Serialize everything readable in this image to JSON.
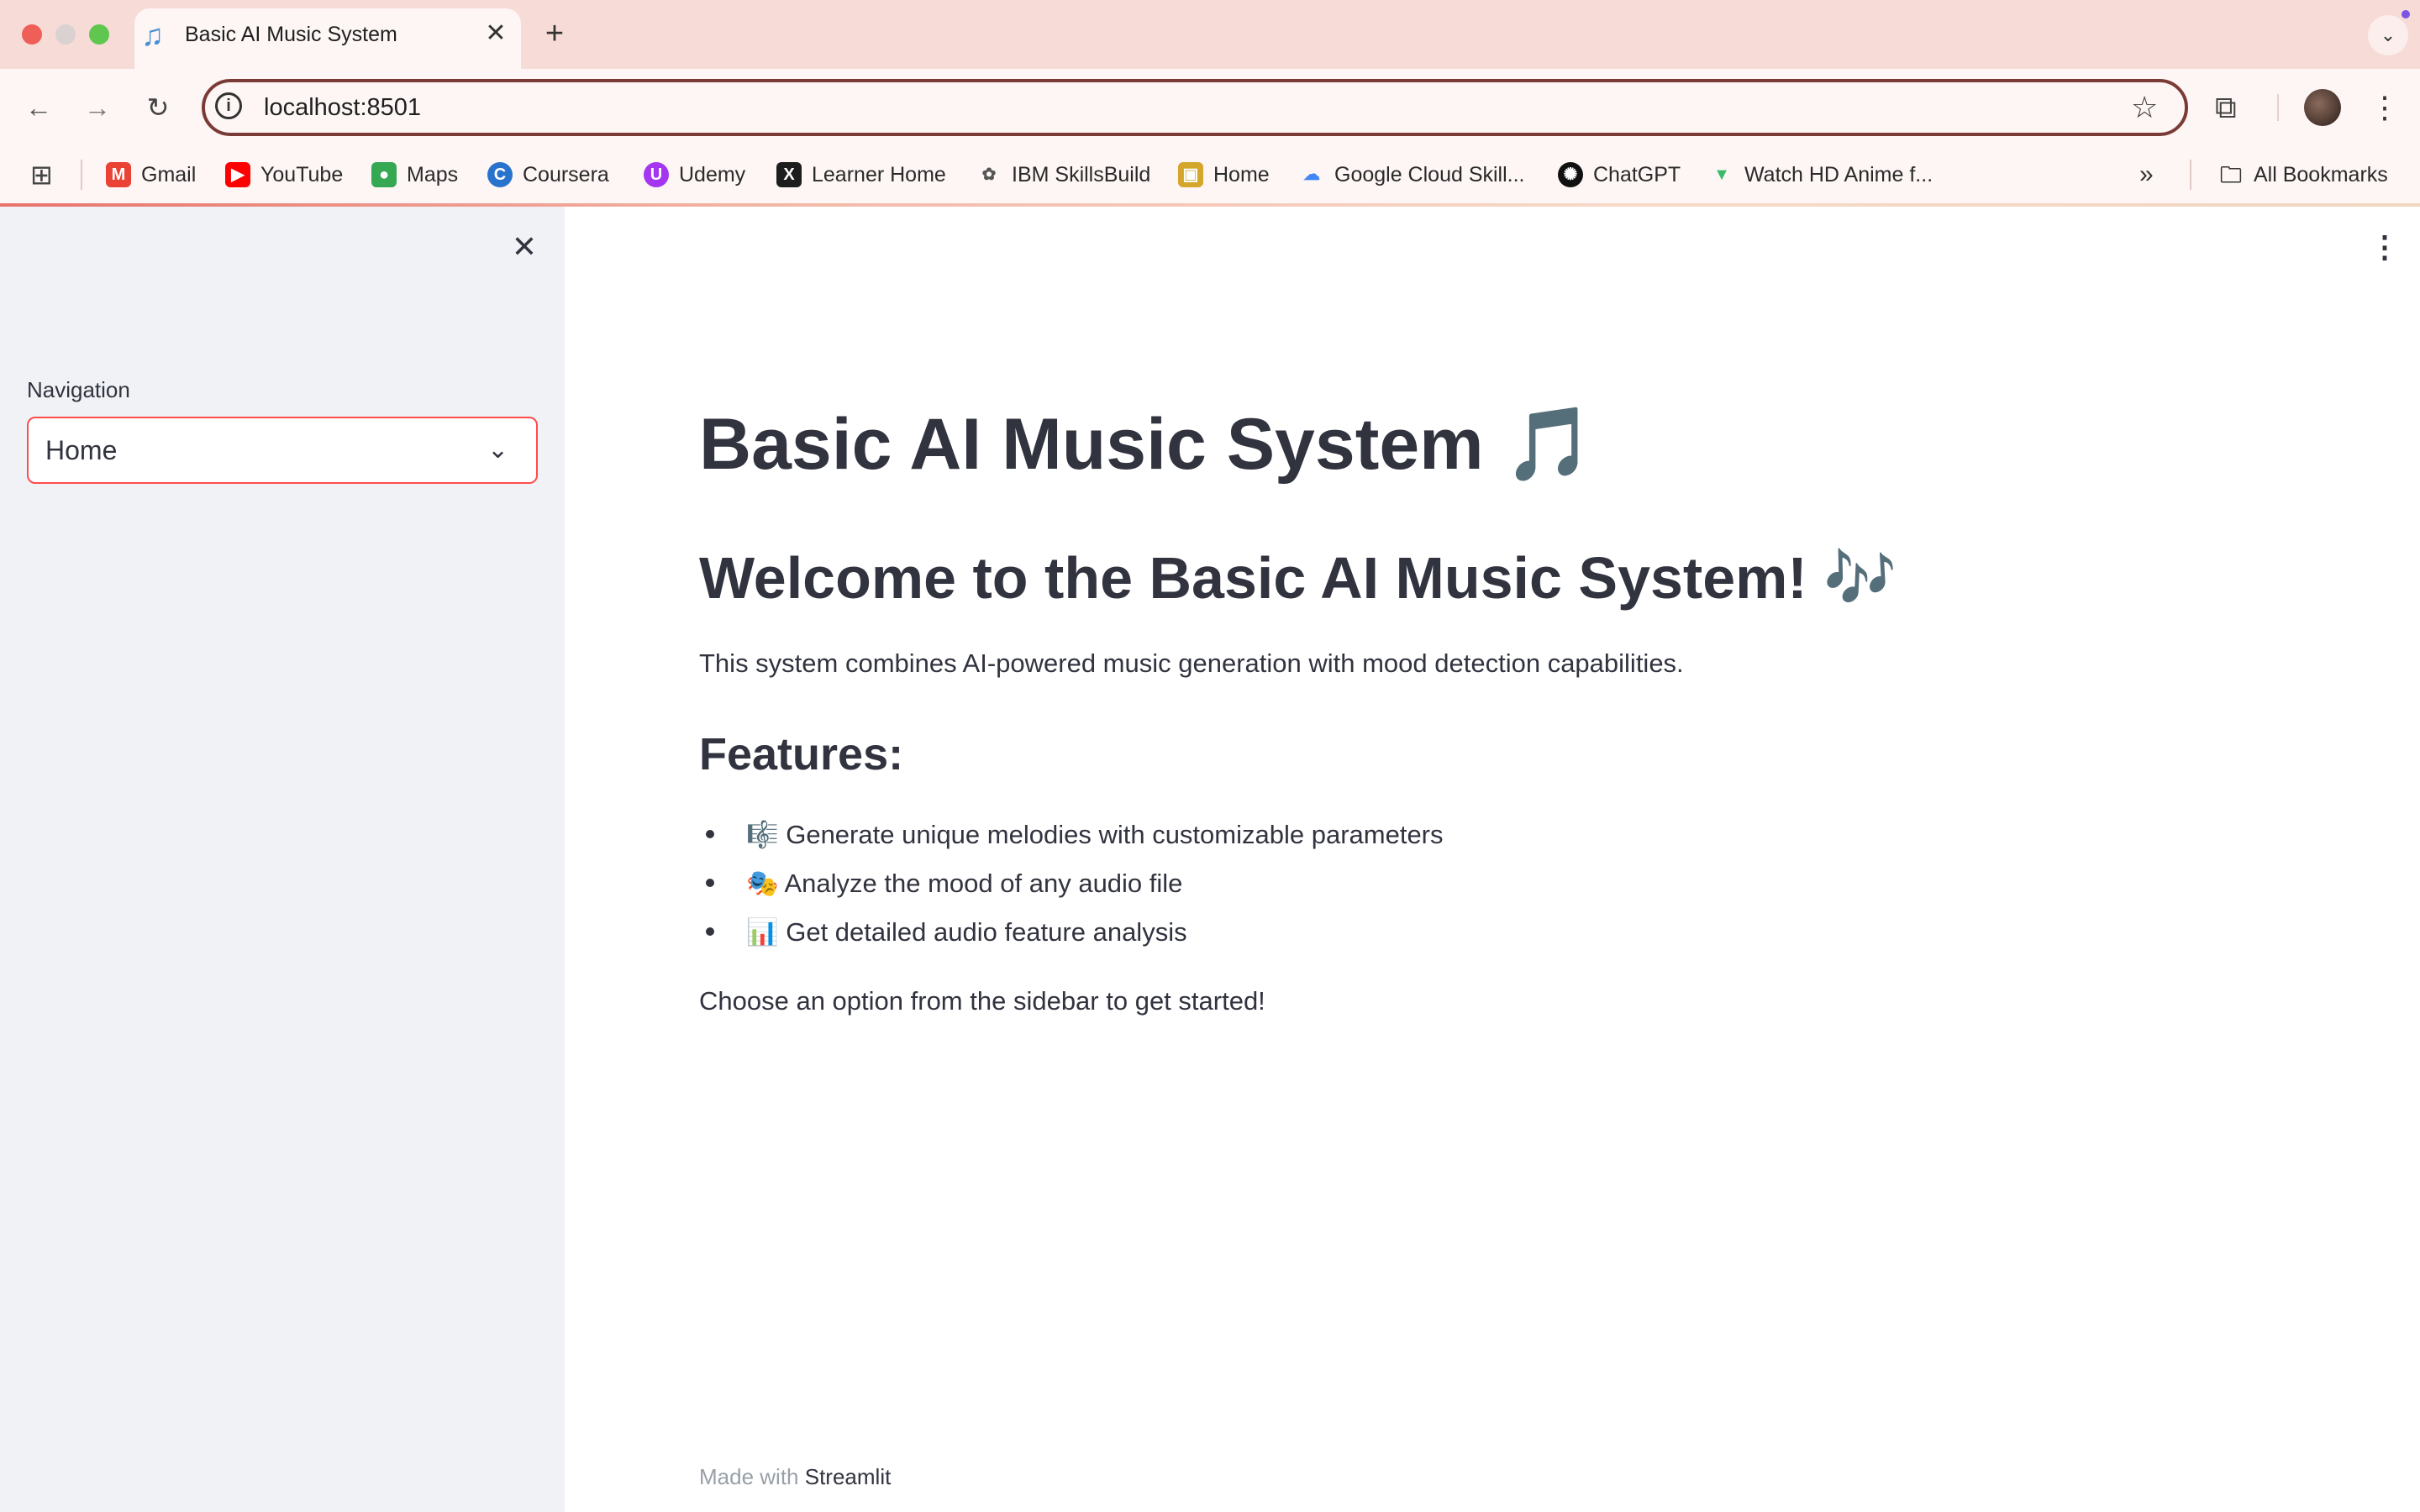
{
  "browser": {
    "tab_title": "Basic AI Music System",
    "tab_icon": "♫",
    "tab_close": "✕",
    "new_tab": "+",
    "url": "localhost:8501",
    "bookmarks": [
      {
        "label": "Gmail",
        "icon": "M",
        "color": "#ea4335"
      },
      {
        "label": "YouTube",
        "icon": "▶",
        "color": "#ff0000"
      },
      {
        "label": "Maps",
        "icon": "●",
        "color": "#34a853"
      },
      {
        "label": "Coursera",
        "icon": "C",
        "color": "#2a73cc"
      },
      {
        "label": "Udemy",
        "icon": "U",
        "color": "#a435f0"
      },
      {
        "label": "Learner Home",
        "icon": "X",
        "color": "#1d1d1d"
      },
      {
        "label": "IBM SkillsBuild",
        "icon": "✿",
        "color": "#555555"
      },
      {
        "label": "Home",
        "icon": "▣",
        "color": "#d4a72c"
      },
      {
        "label": "Google Cloud Skill...",
        "icon": "☁",
        "color": "#4285f4"
      },
      {
        "label": "ChatGPT",
        "icon": "✺",
        "color": "#111111"
      },
      {
        "label": "Watch HD Anime f...",
        "icon": "▼",
        "color": "#3dbb6a"
      }
    ],
    "all_bookmarks": "All Bookmarks"
  },
  "sidebar": {
    "nav_label": "Navigation",
    "nav_value": "Home"
  },
  "main": {
    "title": "Basic AI Music System 🎵",
    "welcome": "Welcome to the Basic AI Music System! 🎶",
    "intro": "This system combines AI-powered music generation with mood detection capabilities.",
    "features_heading": "Features:",
    "features": [
      "🎼 Generate unique melodies with customizable parameters",
      "🎭 Analyze the mood of any audio file",
      "📊 Get detailed audio feature analysis"
    ],
    "cta": "Choose an option from the sidebar to get started!",
    "footer_prefix": "Made with ",
    "footer_brand": "Streamlit"
  }
}
